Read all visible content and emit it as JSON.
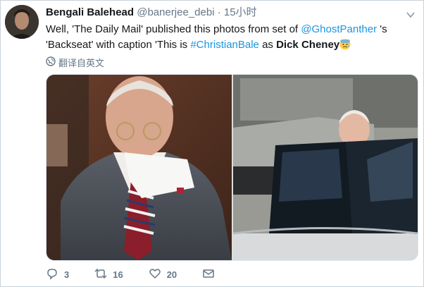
{
  "user": {
    "name": "Bengali Balehead",
    "handle": "@banerjee_debi",
    "separator": "·",
    "time": "15小时"
  },
  "tweet": {
    "text_parts": [
      "Well, 'The Daily Mail' published this photos from set of ",
      "@GhostPanther",
      " 's 'Backseat' with caption 'This is ",
      "#ChristianBale",
      " as ",
      "Dick Cheney"
    ],
    "translate_label": "翻译自英文"
  },
  "actions": {
    "reply_count": "3",
    "retweet_count": "16",
    "like_count": "20"
  },
  "colors": {
    "link": "#1b95e0",
    "muted": "#657786"
  },
  "icons": {
    "caret": "chevron-down-icon",
    "translate": "globe-icon",
    "reply": "reply-icon",
    "retweet": "retweet-icon",
    "like": "heart-icon",
    "dm": "mail-icon",
    "emoji": "anxious-face-emoji"
  }
}
